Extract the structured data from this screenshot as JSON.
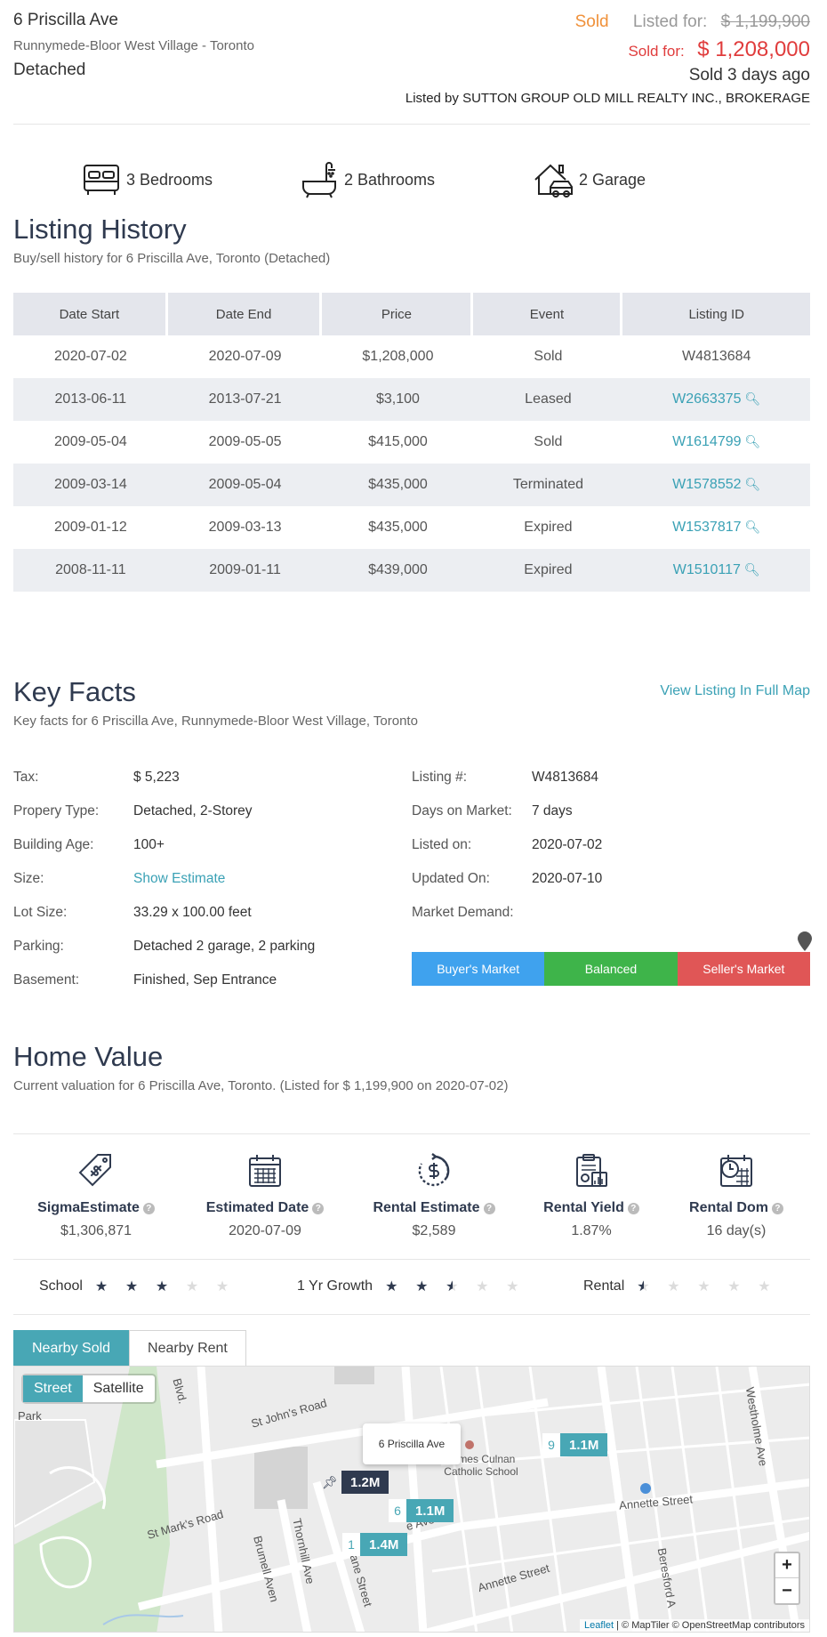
{
  "header": {
    "address": "6 Priscilla Ave",
    "neighbourhood": "Runnymede-Bloor West Village - Toronto",
    "property_type": "Detached",
    "status": "Sold",
    "listed_for_label": "Listed for:",
    "listed_for_price": "$ 1,199,900",
    "sold_for_label": "Sold for:",
    "sold_for_price": "$ 1,208,000",
    "sold_ago": "Sold 3 days ago",
    "listed_by": "Listed by SUTTON GROUP OLD MILL REALTY INC., BROKERAGE"
  },
  "features": {
    "bedrooms": "3 Bedrooms",
    "bathrooms": "2 Bathrooms",
    "garage": "2 Garage"
  },
  "history": {
    "title": "Listing History",
    "subtitle": "Buy/sell history for 6 Priscilla Ave, Toronto (Detached)",
    "columns": [
      "Date Start",
      "Date End",
      "Price",
      "Event",
      "Listing ID"
    ],
    "rows": [
      {
        "start": "2020-07-02",
        "end": "2020-07-09",
        "price": "$1,208,000",
        "event": "Sold",
        "id": "W4813684"
      },
      {
        "start": "2013-06-11",
        "end": "2013-07-21",
        "price": "$3,100",
        "event": "Leased",
        "id": "W2663375"
      },
      {
        "start": "2009-05-04",
        "end": "2009-05-05",
        "price": "$415,000",
        "event": "Sold",
        "id": "W1614799"
      },
      {
        "start": "2009-03-14",
        "end": "2009-05-04",
        "price": "$435,000",
        "event": "Terminated",
        "id": "W1578552"
      },
      {
        "start": "2009-01-12",
        "end": "2009-03-13",
        "price": "$435,000",
        "event": "Expired",
        "id": "W1537817"
      },
      {
        "start": "2008-11-11",
        "end": "2009-01-11",
        "price": "$439,000",
        "event": "Expired",
        "id": "W1510117"
      }
    ]
  },
  "key_facts": {
    "title": "Key Facts",
    "subtitle": "Key facts for 6 Priscilla Ave, Runnymede-Bloor West Village, Toronto",
    "map_link": "View Listing In Full Map",
    "left": [
      {
        "label": "Tax:",
        "value": "$ 5,223"
      },
      {
        "label": "Propery Type:",
        "value": "Detached, 2-Storey"
      },
      {
        "label": "Building Age:",
        "value": "100+"
      },
      {
        "label": "Size:",
        "value": "Show Estimate"
      },
      {
        "label": "Lot Size:",
        "value": "33.29 x 100.00 feet"
      },
      {
        "label": "Parking:",
        "value": "Detached 2 garage, 2 parking"
      },
      {
        "label": "Basement:",
        "value": "Finished, Sep Entrance"
      }
    ],
    "right": [
      {
        "label": "Listing #:",
        "value": "W4813684"
      },
      {
        "label": "Days on Market:",
        "value": "7 days"
      },
      {
        "label": "Listed on:",
        "value": "2020-07-02"
      },
      {
        "label": "Updated On:",
        "value": "2020-07-10"
      },
      {
        "label": "Market Demand:",
        "value": ""
      }
    ],
    "market": {
      "buyer": "Buyer's Market",
      "balanced": "Balanced",
      "seller": "Seller's Market"
    }
  },
  "home_value": {
    "title": "Home Value",
    "subtitle": "Current valuation for 6 Priscilla Ave, Toronto. (Listed for $ 1,199,900 on 2020-07-02)",
    "cards": [
      {
        "label": "SigmaEstimate",
        "value": "$1,306,871",
        "icon": "price-tag-icon"
      },
      {
        "label": "Estimated Date",
        "value": "2020-07-09",
        "icon": "calendar-icon"
      },
      {
        "label": "Rental Estimate",
        "value": "$2,589",
        "icon": "dollar-refresh-icon"
      },
      {
        "label": "Rental Yield",
        "value": "1.87%",
        "icon": "clipboard-chart-icon"
      },
      {
        "label": "Rental Dom",
        "value": "16 day(s)",
        "icon": "calendar-clock-icon"
      }
    ],
    "ratings": [
      {
        "label": "School",
        "stars": 3
      },
      {
        "label": "1 Yr Growth",
        "stars": 2.5
      },
      {
        "label": "Rental",
        "stars": 0.5
      }
    ]
  },
  "map": {
    "tabs": [
      "Nearby Sold",
      "Nearby Rent"
    ],
    "layers": [
      "Street",
      "Satellite"
    ],
    "popup": "6 Priscilla Ave",
    "markers": [
      {
        "label": "1.2M"
      },
      {
        "num": "9",
        "label": "1.1M"
      },
      {
        "num": "6",
        "label": "1.1M"
      },
      {
        "num": "1",
        "label": "1.4M"
      }
    ],
    "streets": [
      "St John's Road",
      "St Mark's Road",
      "Annette Street",
      "Annette Street",
      "Brumell Aven",
      "Thornhill Ave",
      "Jane Street",
      "Westholme Ave",
      "Beresford A",
      "Park",
      "Blvd.",
      "e Avenue"
    ],
    "poi": "James Culnan Catholic School",
    "attribution_link": "Leaflet",
    "attribution": " | © MapTiler © OpenStreetMap contributors",
    "zoom_in": "+",
    "zoom_out": "−"
  },
  "colors": {
    "accent": "#48a7b5",
    "sold": "#f0913a",
    "red": "#e03c3c",
    "navy": "#2f3a4f"
  }
}
